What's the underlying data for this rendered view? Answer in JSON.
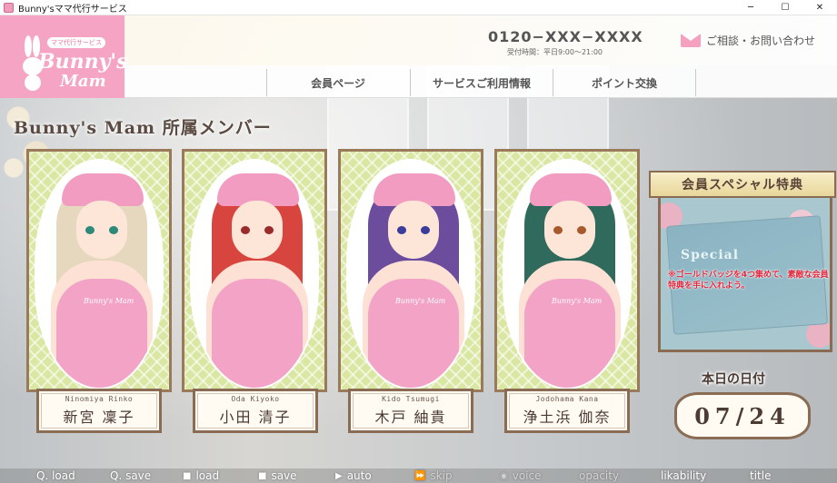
{
  "window": {
    "title": "Bunny'sママ代行サービス",
    "controls": [
      "─",
      "☐",
      "✕"
    ]
  },
  "header": {
    "logo_badge": "ママ代行サービス",
    "logo_main": "Bunny's",
    "logo_sub": "Mam",
    "phone": "0120−XXX−XXXX",
    "hours": "受付時間：平日9:00〜21:00",
    "contact": "ご相談・お問い合わせ"
  },
  "nav": {
    "items": [
      "会員ページ",
      "サービスご利用情報",
      "ポイント交換"
    ]
  },
  "section_title": "Bunny's  Mam 所属メンバー",
  "members": [
    {
      "romaji": "Ninomiya Rinko",
      "name": "新宮 凜子",
      "apron": "Bunny's Mam"
    },
    {
      "romaji": "Oda Kiyoko",
      "name": "小田 清子",
      "apron": ""
    },
    {
      "romaji": "Kido Tsumugi",
      "name": "木戸 紬貴",
      "apron": "Bunny's Mam"
    },
    {
      "romaji": "Jodohama Kana",
      "name": "浄土浜 伽奈",
      "apron": "Bunny's Mam"
    }
  ],
  "special": {
    "banner": "会員スペシャル特典",
    "card_word": "Special",
    "notice": "※ゴールドバッジを4つ集めて、素敵な会員特典を手に入れよう。"
  },
  "date": {
    "label": "本日の日付",
    "value": "07/24"
  },
  "menu": {
    "items": [
      "Q. load",
      "Q. save",
      "load",
      "save",
      "auto",
      "skip",
      "voice",
      "opacity",
      "likability",
      "title"
    ]
  },
  "colors": {
    "brand_pink": "#f5a5c3",
    "frame_brown": "#8a6b54",
    "lattice_green": "#d9e7a3",
    "notice_red": "#e3263b"
  }
}
